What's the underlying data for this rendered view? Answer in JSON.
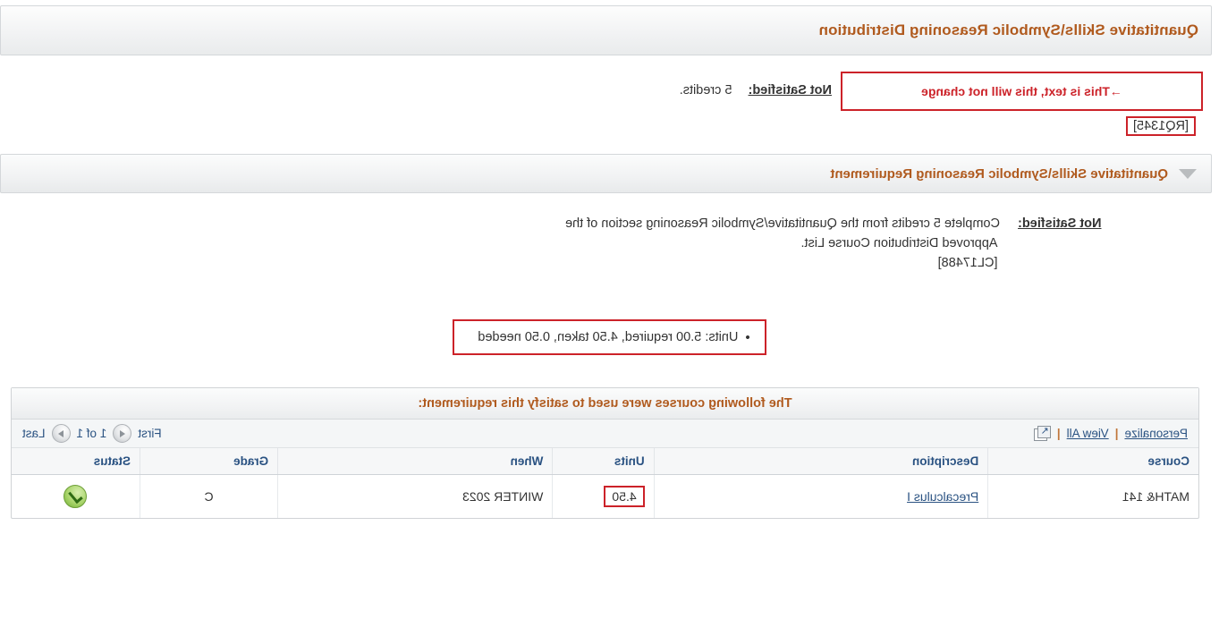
{
  "distribution": {
    "header_title": "Quantitative Skills\\Symbolic Reasoning Distribution",
    "status_label": "Not Satisfied:",
    "status_text": "5 credits.",
    "callout_text": "→This is text, this will not change",
    "code": "[RQ1345]"
  },
  "requirement": {
    "header_title": "Quantitative Skills\\Symbolic Reasoning Requirement",
    "collapse_icon": "triangle-down-icon",
    "status_label": "Not Satisfied:",
    "status_text_line1": "Complete 5 credits from the Quantitative/Symbolic Reasoning section of the",
    "status_text_line2": "Approved Distribution Course List.",
    "code": "[CL17488]",
    "units_bullet": "•",
    "units_text": "Units: 5.00 required, 4.50 taken, 0.50 needed"
  },
  "courses_panel": {
    "caption": "The following courses were used to satisfy this requirement:",
    "toolbar": {
      "personalize_label": "Personalize",
      "separator": "|",
      "view_all_label": "View All",
      "expand_icon": "expand-grid-icon",
      "first_label": "First",
      "prev_icon": "prev-arrow-icon",
      "page_indicator": "1 of 1",
      "next_icon": "next-arrow-icon",
      "last_label": "Last"
    },
    "columns": [
      "Course",
      "Description",
      "Units",
      "When",
      "Grade",
      "Status"
    ],
    "rows": [
      {
        "course": "MATH& 141",
        "description": "Precalculus I",
        "units": "4.50",
        "when": "WINTER 2023",
        "grade": "C",
        "status_icon": "green-check-icon"
      }
    ]
  },
  "colors": {
    "header_accent": "#b05a1e",
    "link": "#2a5282",
    "highlight_border": "#cc2229",
    "status_ok": "#6fae32"
  }
}
